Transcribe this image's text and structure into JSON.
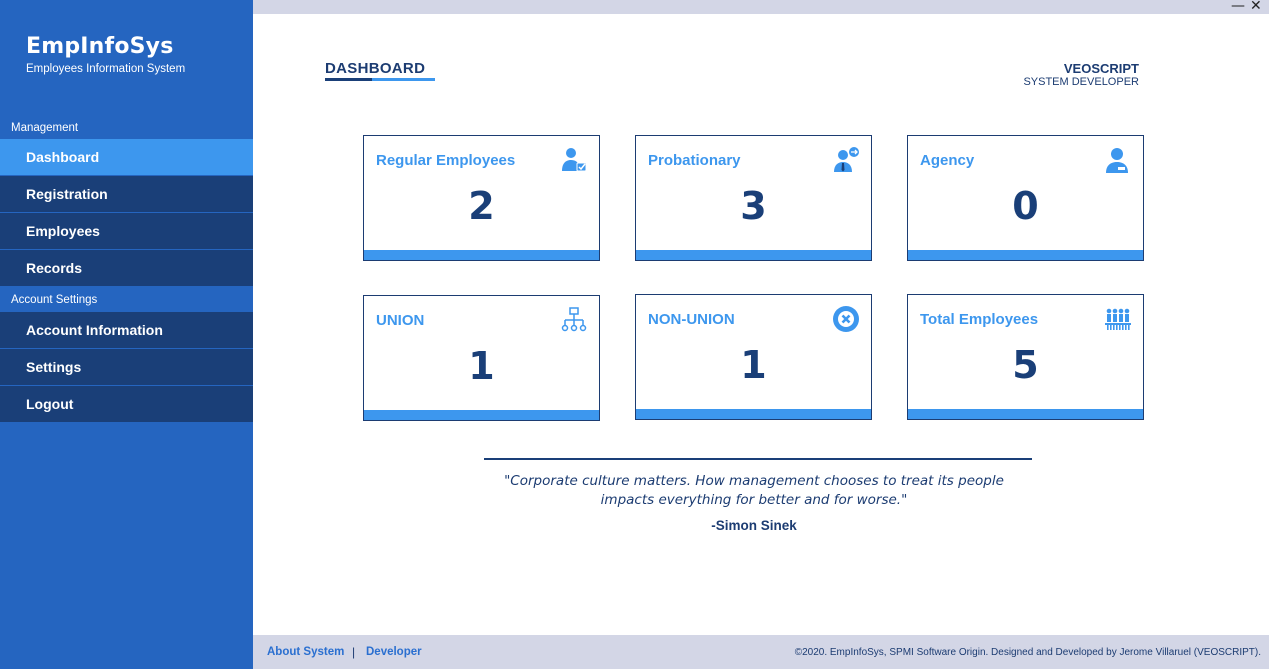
{
  "brand": {
    "name": "EmpInfoSys",
    "subtitle": "Employees Information System"
  },
  "sidebar": {
    "management_label": "Management",
    "management_items": [
      {
        "label": "Dashboard",
        "active": true
      },
      {
        "label": "Registration"
      },
      {
        "label": "Employees"
      },
      {
        "label": "Records"
      }
    ],
    "account_label": "Account Settings",
    "account_items": [
      {
        "label": "Account Information"
      },
      {
        "label": "Settings"
      },
      {
        "label": "Logout"
      }
    ]
  },
  "window": {
    "minimize": "—",
    "close": "✕"
  },
  "header": {
    "title": "DASHBOARD",
    "user_name": "VEOSCRIPT",
    "user_role": "SYSTEM DEVELOPER"
  },
  "cards": [
    {
      "label": "Regular Employees",
      "value": "2",
      "icon": "user-check-icon"
    },
    {
      "label": "Probationary",
      "value": "3",
      "icon": "user-tie-icon"
    },
    {
      "label": "Agency",
      "value": "0",
      "icon": "user-badge-icon"
    },
    {
      "label": "UNION",
      "value": "1",
      "icon": "org-chart-icon"
    },
    {
      "label": "NON-UNION",
      "value": "1",
      "icon": "x-circle-icon"
    },
    {
      "label": "Total Employees",
      "value": "5",
      "icon": "group-icon"
    }
  ],
  "quote": {
    "line1": "\"Corporate culture matters. How management chooses to treat its people",
    "line2": "impacts everything for better and for worse.\"",
    "author": "-Simon Sinek"
  },
  "footer": {
    "about": "About System",
    "separator": "|",
    "developer": "Developer",
    "copyright": "©2020. EmpInfoSys, SPMI Software Origin. Designed and Developed by Jerome Villaruel (VEOSCRIPT)."
  },
  "colors": {
    "sidebar": "#2565c0",
    "nav": "#1a3f78",
    "accent": "#3d97ee",
    "text_dark": "#1c3c72"
  }
}
